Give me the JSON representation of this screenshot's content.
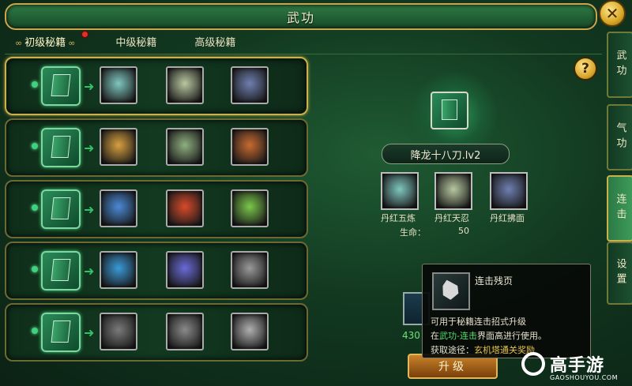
{
  "window": {
    "title": "武功"
  },
  "tabs": [
    {
      "label": "初级秘籍",
      "active": true,
      "badge": true
    },
    {
      "label": "中级秘籍",
      "active": false,
      "badge": false
    },
    {
      "label": "高级秘籍",
      "active": false,
      "badge": false
    }
  ],
  "side_tabs": [
    {
      "label": "武功",
      "active": false
    },
    {
      "label": "气功",
      "active": false
    },
    {
      "label": "连击",
      "active": true
    },
    {
      "label": "设置",
      "active": false
    }
  ],
  "rows": [
    {
      "selected": true,
      "skills": [
        "#7fc7c0",
        "#b8c8a0",
        "#6f7fb0"
      ]
    },
    {
      "selected": false,
      "skills": [
        "#d8a040",
        "#8fb080",
        "#c86a30"
      ]
    },
    {
      "selected": false,
      "skills": [
        "#4a8ad8",
        "#d84a2a",
        "#7ac84a"
      ]
    },
    {
      "selected": false,
      "skills": [
        "#3a9ad8",
        "#6a6ad8",
        "#9a9a9a"
      ]
    },
    {
      "selected": false,
      "skills": [
        "#7a7a7a",
        "#8a8a8a",
        "#b0b0b0"
      ]
    }
  ],
  "detail": {
    "skill_name": "降龙十八刀.lv2",
    "materials": [
      {
        "label": "丹红五炼",
        "color": "#7fc7c0"
      },
      {
        "label": "丹红天忍",
        "color": "#b8c8a0"
      },
      {
        "label": "丹红拂面",
        "color": "#6f7fb0"
      }
    ],
    "stat_label": "生命：",
    "stat_value": "50",
    "cost_value": "430",
    "upgrade_label": "升级"
  },
  "tooltip": {
    "title": "连击残页",
    "line1": "可用于秘籍连击招式升级",
    "line2_prefix": "在",
    "line2_highlight": "武功-连击",
    "line2_suffix": "界面高进行使用。",
    "line3_label": "获取途径：",
    "line3_value": "玄机塔通关奖励"
  },
  "watermark": {
    "text": "高手游",
    "url": "GAOSHOUYOU.COM"
  }
}
